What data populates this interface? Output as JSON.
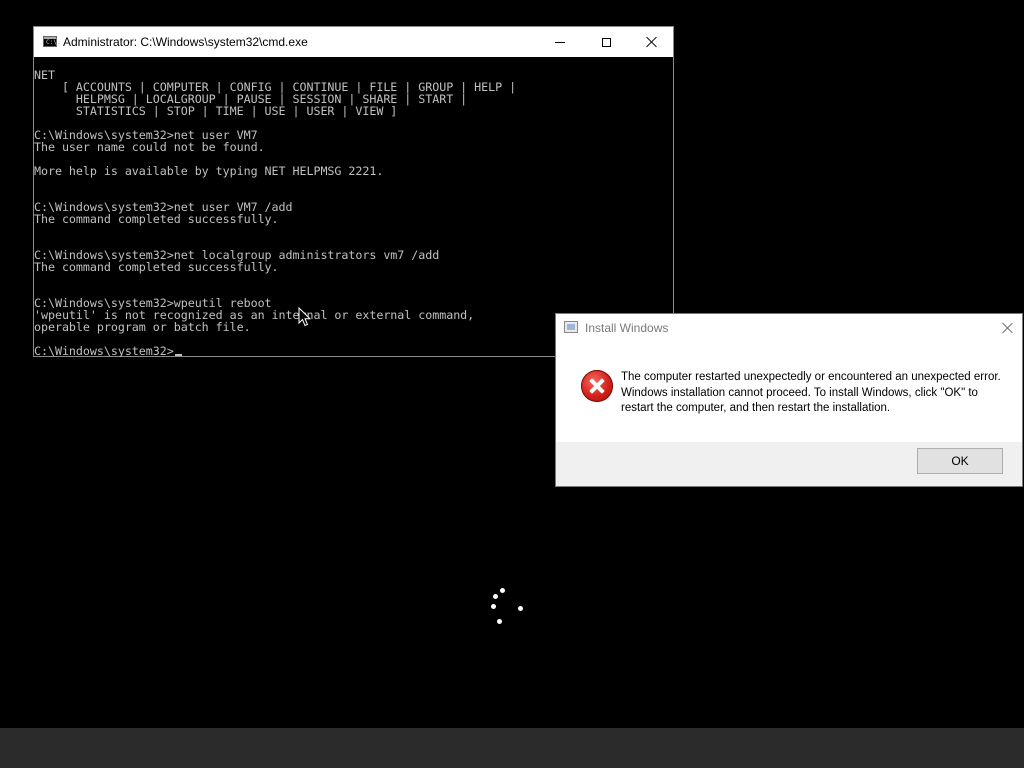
{
  "cmd_window": {
    "title": "Administrator: C:\\Windows\\system32\\cmd.exe",
    "icon_text": "C:\\.",
    "lines": [
      "NET",
      "    [ ACCOUNTS | COMPUTER | CONFIG | CONTINUE | FILE | GROUP | HELP |",
      "      HELPMSG | LOCALGROUP | PAUSE | SESSION | SHARE | START |",
      "      STATISTICS | STOP | TIME | USE | USER | VIEW ]",
      "",
      "C:\\Windows\\system32>net user VM7",
      "The user name could not be found.",
      "",
      "More help is available by typing NET HELPMSG 2221.",
      "",
      "",
      "C:\\Windows\\system32>net user VM7 /add",
      "The command completed successfully.",
      "",
      "",
      "C:\\Windows\\system32>net localgroup administrators vm7 /add",
      "The command completed successfully.",
      "",
      "",
      "C:\\Windows\\system32>wpeutil reboot",
      "'wpeutil' is not recognized as an internal or external command,",
      "operable program or batch file.",
      "",
      "C:\\Windows\\system32>"
    ]
  },
  "dialog": {
    "title": "Install Windows",
    "message": "The computer restarted unexpectedly or encountered an unexpected error. Windows installation cannot proceed. To install Windows, click \"OK\" to restart the computer, and then restart the installation.",
    "ok_label": "OK"
  },
  "colors": {
    "console_text": "#c0c0c0",
    "console_background": "#000000",
    "error_red": "#d21f1a"
  }
}
